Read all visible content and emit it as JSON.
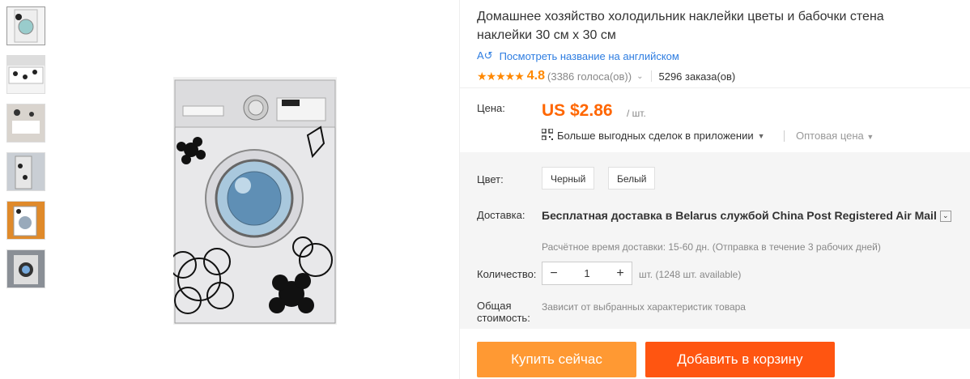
{
  "thumbnails": [
    "thumb-1",
    "thumb-2",
    "thumb-3",
    "thumb-4",
    "thumb-5",
    "thumb-6"
  ],
  "product": {
    "title": "Домашнее хозяйство холодильник наклейки цветы и бабочки стена наклейки 30 см x 30 см",
    "translate_link": "Посмотреть название на английском",
    "rating": "4.8",
    "votes": "(3386 голоса(ов))",
    "orders": "5296 заказа(ов)"
  },
  "price": {
    "label": "Цена:",
    "value": "US $2.86",
    "unit": "/ шт.",
    "app_deals": "Больше выгодных сделок в приложении",
    "wholesale": "Оптовая цена"
  },
  "options": {
    "color_label": "Цвет:",
    "colors": [
      "Черный",
      "Белый"
    ]
  },
  "shipping": {
    "label": "Доставка:",
    "main": "Бесплатная доставка в Belarus службой China Post Registered Air Mail",
    "estimate": "Расчётное время доставки: 15-60 дн. (Отправка в течение 3 рабочих дней)"
  },
  "quantity": {
    "label": "Количество:",
    "value": "1",
    "minus": "−",
    "plus": "+",
    "available": "шт. (1248 шт. available)"
  },
  "total": {
    "label": "Общая стоимость:",
    "note": "Зависит от выбранных характеристик товара"
  },
  "actions": {
    "buy_now": "Купить сейчас",
    "add_to_cart": "Добавить в корзину"
  },
  "colors": {
    "accent": "#ff6600",
    "buy": "#ff9933",
    "cart": "#ff5511",
    "link": "#2e7de1"
  }
}
